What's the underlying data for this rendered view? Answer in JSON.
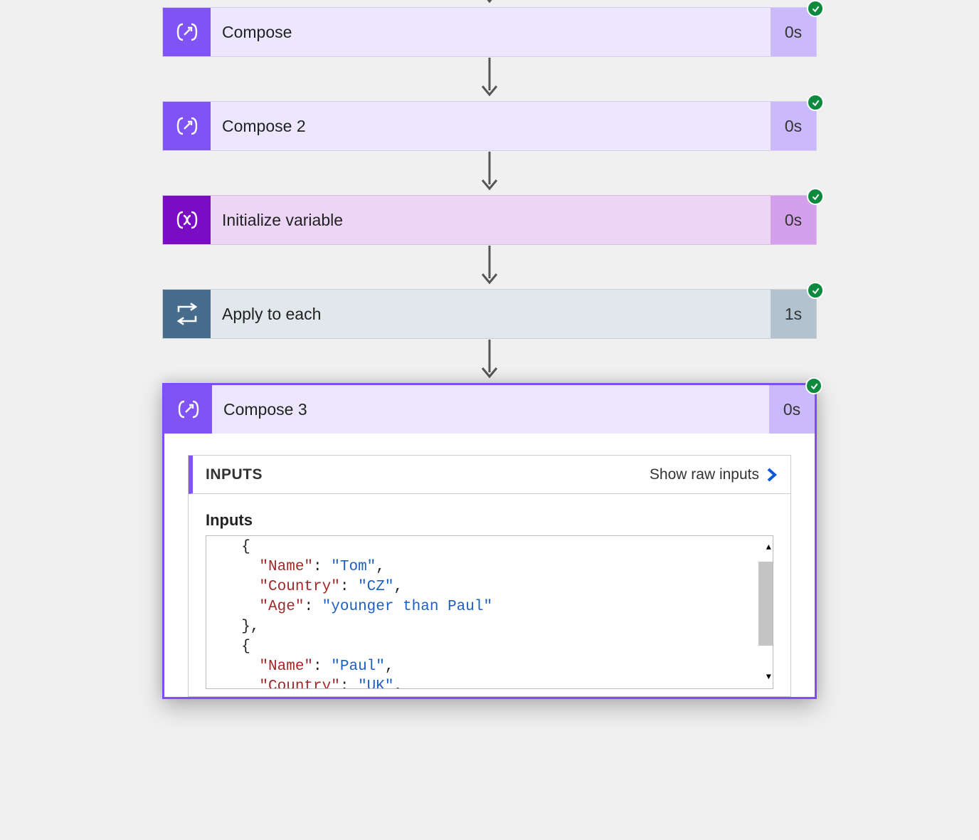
{
  "arrowColor": "#555",
  "steps": [
    {
      "id": "compose1",
      "kind": "compose",
      "title": "Compose",
      "duration": "0s",
      "iconName": "compose-icon"
    },
    {
      "id": "compose2",
      "kind": "compose",
      "title": "Compose 2",
      "duration": "0s",
      "iconName": "compose-icon"
    },
    {
      "id": "initvar",
      "kind": "init",
      "title": "Initialize variable",
      "duration": "0s",
      "iconName": "variable-icon"
    },
    {
      "id": "applyeach",
      "kind": "loop",
      "title": "Apply to each",
      "duration": "1s",
      "iconName": "loop-icon"
    }
  ],
  "expanded": {
    "title": "Compose 3",
    "duration": "0s",
    "iconName": "compose-icon",
    "panel": {
      "headerLabel": "INPUTS",
      "rawLinkLabel": "Show raw inputs",
      "bodyLabel": "Inputs",
      "code": {
        "lines": [
          [
            {
              "t": "  {",
              "c": "p"
            }
          ],
          [
            {
              "t": "    ",
              "c": "p"
            },
            {
              "t": "\"Name\"",
              "c": "k"
            },
            {
              "t": ": ",
              "c": "p"
            },
            {
              "t": "\"Tom\"",
              "c": "v"
            },
            {
              "t": ",",
              "c": "p"
            }
          ],
          [
            {
              "t": "    ",
              "c": "p"
            },
            {
              "t": "\"Country\"",
              "c": "k"
            },
            {
              "t": ": ",
              "c": "p"
            },
            {
              "t": "\"CZ\"",
              "c": "v"
            },
            {
              "t": ",",
              "c": "p"
            }
          ],
          [
            {
              "t": "    ",
              "c": "p"
            },
            {
              "t": "\"Age\"",
              "c": "k"
            },
            {
              "t": ": ",
              "c": "p"
            },
            {
              "t": "\"younger than Paul\"",
              "c": "v"
            }
          ],
          [
            {
              "t": "  },",
              "c": "p"
            }
          ],
          [
            {
              "t": "  {",
              "c": "p"
            }
          ],
          [
            {
              "t": "    ",
              "c": "p"
            },
            {
              "t": "\"Name\"",
              "c": "k"
            },
            {
              "t": ": ",
              "c": "p"
            },
            {
              "t": "\"Paul\"",
              "c": "v"
            },
            {
              "t": ",",
              "c": "p"
            }
          ],
          [
            {
              "t": "    ",
              "c": "p"
            },
            {
              "t": "\"Country\"",
              "c": "k"
            },
            {
              "t": ": ",
              "c": "p"
            },
            {
              "t": "\"UK\"",
              "c": "v"
            },
            {
              "t": ",",
              "c": "p"
            }
          ]
        ]
      }
    }
  }
}
